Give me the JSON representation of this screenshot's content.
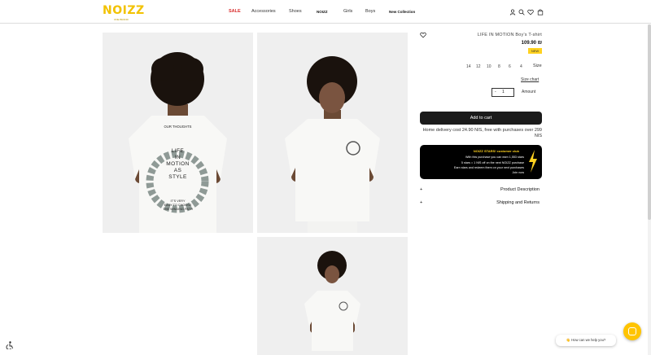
{
  "brand": {
    "logo": "NOIZZ",
    "tagline": "ONE BRAND"
  },
  "nav": {
    "items": [
      "SALE",
      "Accessories",
      "Shoes",
      "NOIZZ",
      "Girls",
      "Boys",
      "New Collection"
    ]
  },
  "header_icons": [
    "user-icon",
    "search-icon",
    "heart-icon",
    "bag-icon"
  ],
  "product": {
    "title": "LIFE IN MOTION Boy's T-shirt",
    "price": "109.90 ₪",
    "badge": "NEW",
    "sizes": [
      "14",
      "12",
      "10",
      "8",
      "6",
      "4"
    ],
    "size_label": "Size",
    "size_chart_label": "Size chart",
    "quantity": "1",
    "quantity_minus": "-",
    "amount_label": "Amount",
    "add_to_cart": "Add to cart",
    "delivery_text": "Home delivery cost 24.90 NIS, free with purchases over 299 NIS"
  },
  "club": {
    "title": "NOIZZ STARS! customer club",
    "lines": [
      "With this purchase you can earn 1,553 stars",
      "5 stars = 1 NIS off on the next NOIZZ purchase",
      "Earn stars and redeem them on your next purchases",
      "Join now"
    ]
  },
  "accordions": [
    {
      "plus": "+",
      "title": "Product Description"
    },
    {
      "plus": "+",
      "title": "Shipping and Returns"
    }
  ],
  "shirt_print": {
    "top_lines": [
      "OUR THOUGHTS"
    ],
    "center_lines": [
      "LIFE",
      "IN",
      "MOTION",
      "AS",
      "STYLE"
    ],
    "bottom_lines": [
      "IT'S VERY",
      "EASY TO CHOOSE",
      "THE WINDING PATH"
    ]
  },
  "chat": {
    "bubble_text": "👋 How can we help you?"
  },
  "colors": {
    "brand_yellow": "#f2c200",
    "sale_red": "#d92b2b",
    "cart_black": "#1b1b1b",
    "badge_yellow": "#ffd21f"
  }
}
